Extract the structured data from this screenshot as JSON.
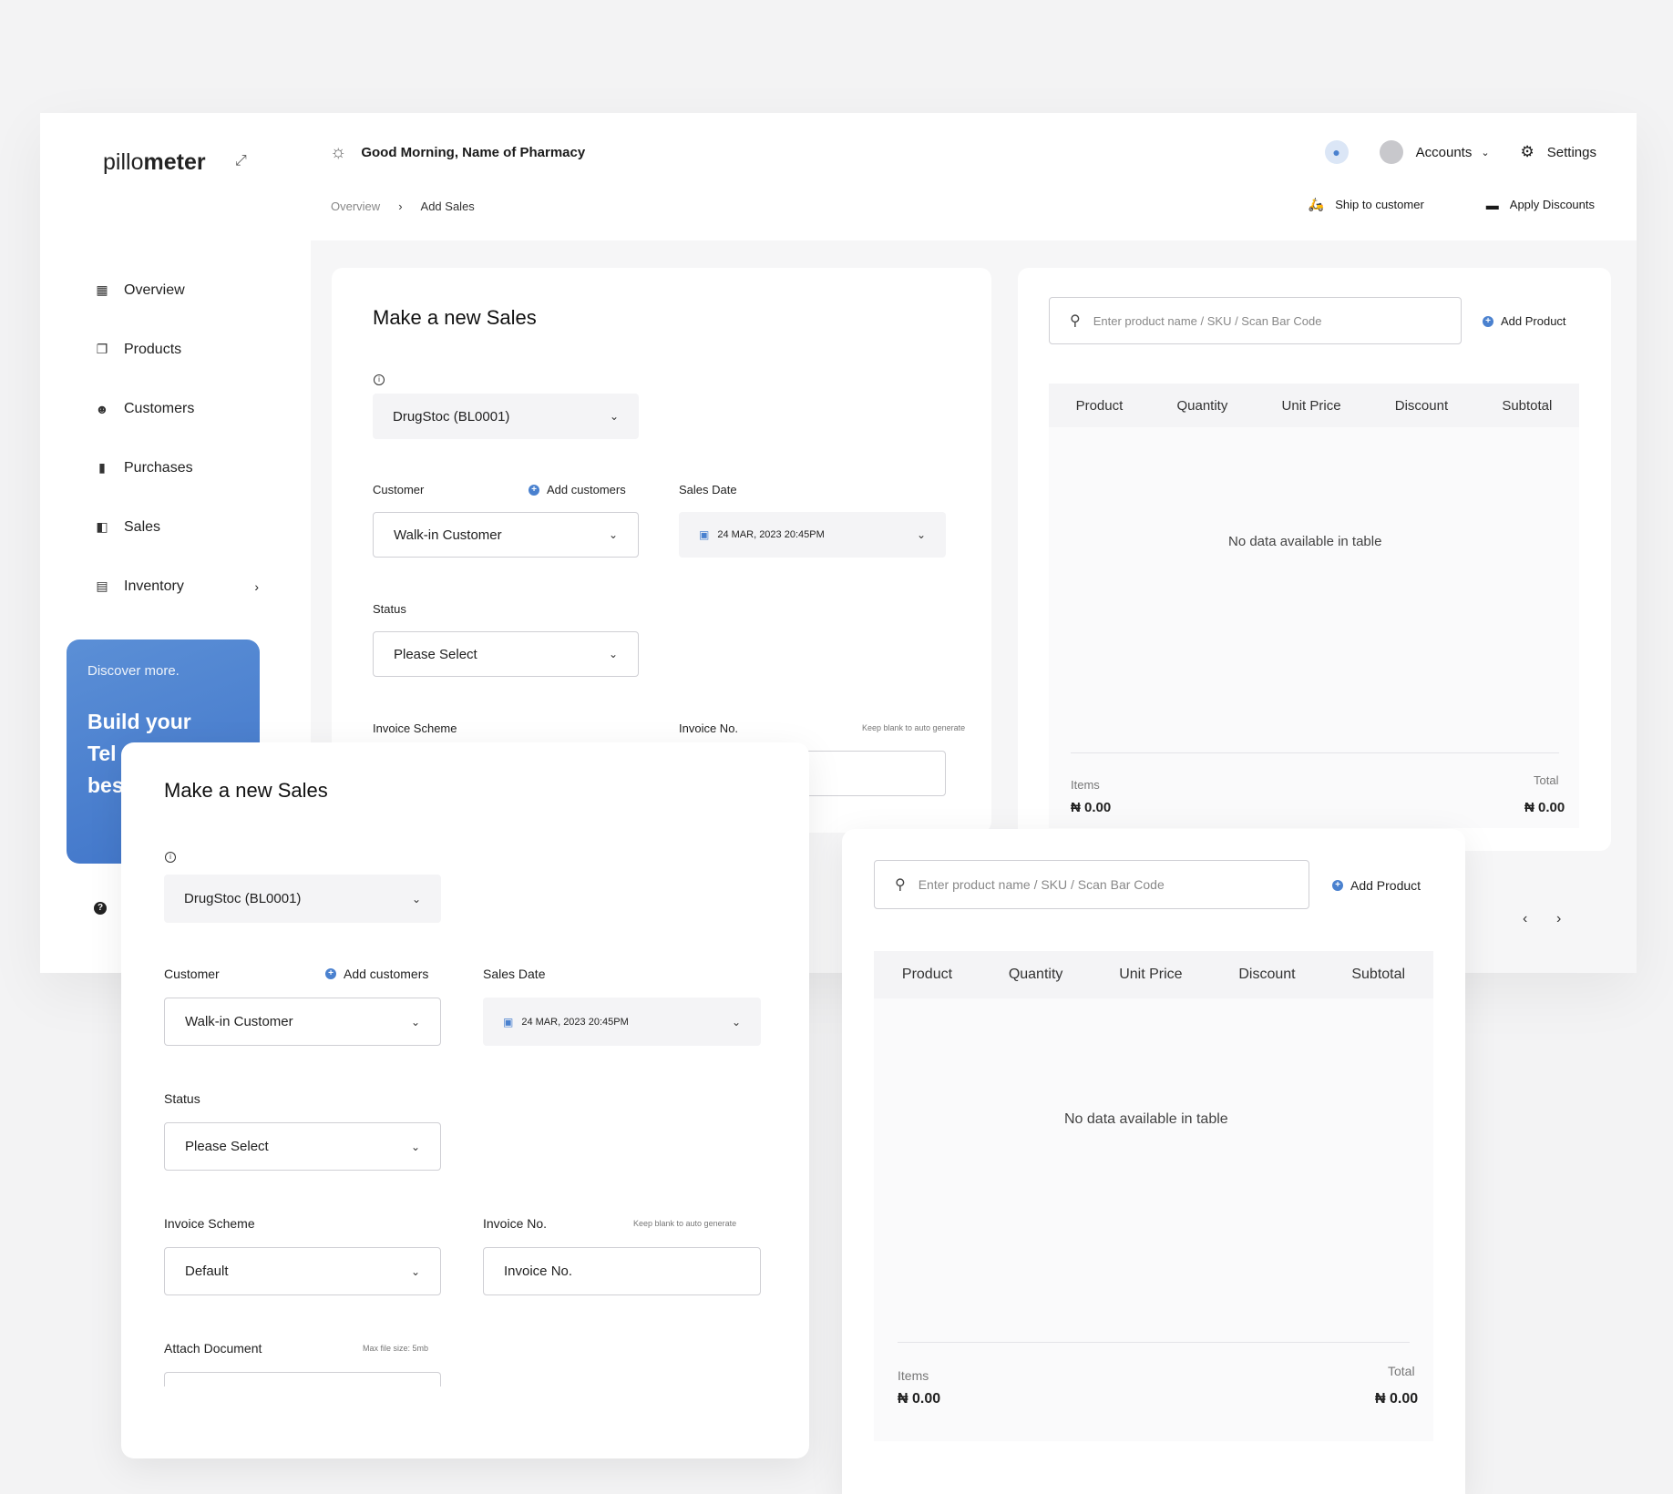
{
  "brand": {
    "prefix": "pillo",
    "suffix": "meter"
  },
  "greeting": "Good Morning, Name of Pharmacy",
  "breadcrumb": [
    "Overview",
    "Add Sales"
  ],
  "topbar": {
    "accounts": "Accounts",
    "settings": "Settings"
  },
  "actions": {
    "ship": "Ship to customer",
    "discounts": "Apply Discounts"
  },
  "sidebar": {
    "items": [
      {
        "label": "Overview",
        "icon": "dashboard-icon"
      },
      {
        "label": "Products",
        "icon": "products-icon"
      },
      {
        "label": "Customers",
        "icon": "customers-icon"
      },
      {
        "label": "Purchases",
        "icon": "purchases-icon"
      },
      {
        "label": "Sales",
        "icon": "sales-icon"
      },
      {
        "label": "Inventory",
        "icon": "inventory-icon"
      }
    ]
  },
  "promo": {
    "small": "Discover more.",
    "line1": "Build your",
    "line2": "Tel",
    "line3": "bes"
  },
  "form": {
    "title": "Make a new Sales",
    "location": "DrugStoc (BL0001)",
    "customer_label": "Customer",
    "add_customers": "Add customers",
    "customer_value": "Walk-in Customer",
    "sales_date_label": "Sales Date",
    "sales_date_value": "24 MAR, 2023  20:45PM",
    "status_label": "Status",
    "status_value": "Please Select",
    "invoice_scheme_label": "Invoice Scheme",
    "invoice_scheme_value": "Default",
    "invoice_no_label": "Invoice No.",
    "invoice_no_hint": "Keep blank to auto generate",
    "invoice_no_placeholder": "Invoice No.",
    "attach_label": "Attach Document",
    "attach_hint": "Max file size: 5mb"
  },
  "products": {
    "search_placeholder": "Enter product name / SKU / Scan Bar Code",
    "add_product": "Add Product",
    "columns": [
      "Product",
      "Quantity",
      "Unit Price",
      "Discount",
      "Subtotal"
    ],
    "empty": "No data available in table",
    "items_label": "Items",
    "items_value": "₦ 0.00",
    "total_label": "Total",
    "total_value": "₦ 0.00"
  }
}
